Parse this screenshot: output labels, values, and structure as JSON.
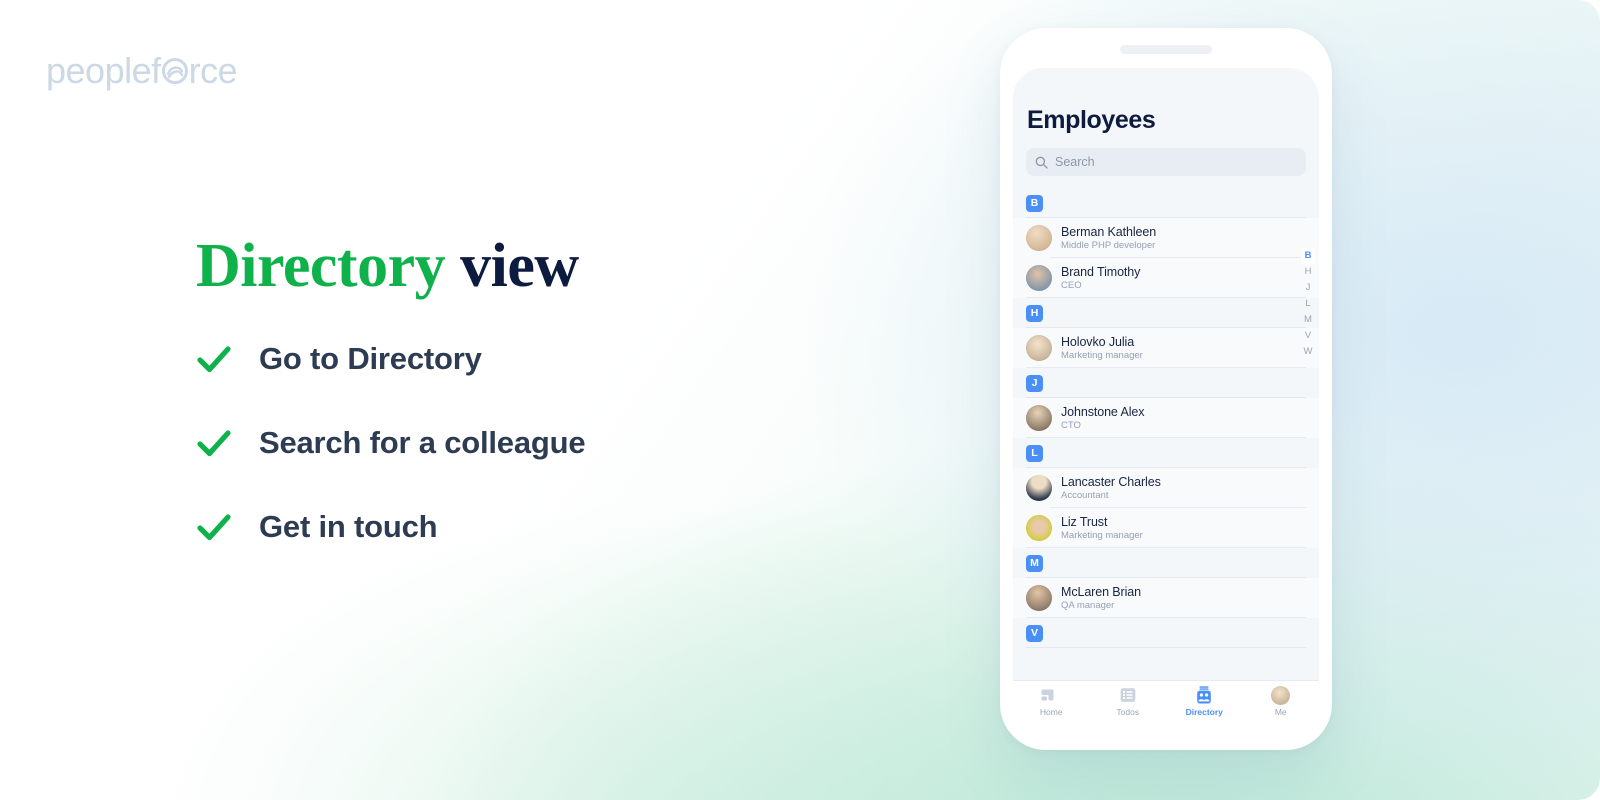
{
  "brand": {
    "logo_text_before": "peoplef",
    "logo_icon": "swirl-o-icon",
    "logo_text_after": "rce",
    "logo_color": "#ccd8e4",
    "green": "#0fb14b",
    "navy": "#0d1b3e",
    "blue": "#4a8ff5"
  },
  "headline": {
    "highlight": "Directory",
    "space": " ",
    "rest": "view"
  },
  "checklist": {
    "items": [
      {
        "icon": "check-icon",
        "label": "Go to Directory"
      },
      {
        "icon": "check-icon",
        "label": "Search for a colleague"
      },
      {
        "icon": "check-icon",
        "label": "Get in touch"
      }
    ]
  },
  "phone": {
    "screen": {
      "title": "Employees",
      "search": {
        "icon": "search-icon",
        "placeholder": "Search",
        "value": ""
      },
      "sections": [
        {
          "letter": "B",
          "employees": [
            {
              "name": "Berman Kathleen",
              "role": "Middle PHP developer",
              "avatar": "#d9c3a8"
            },
            {
              "name": "Brand Timothy",
              "role": "CEO",
              "avatar": "#6f9bc4"
            }
          ]
        },
        {
          "letter": "H",
          "employees": [
            {
              "name": "Holovko Julia",
              "role": "Marketing manager",
              "avatar": "#c9b79c"
            }
          ]
        },
        {
          "letter": "J",
          "employees": [
            {
              "name": "Johnstone Alex",
              "role": "CTO",
              "avatar": "#9a8b78"
            }
          ]
        },
        {
          "letter": "L",
          "employees": [
            {
              "name": "Lancaster Charles",
              "role": "Accountant",
              "avatar": "#445066"
            },
            {
              "name": "Liz Trust",
              "role": "Marketing manager",
              "avatar": "#d8cf3d"
            }
          ]
        },
        {
          "letter": "M",
          "employees": [
            {
              "name": "McLaren Brian",
              "role": "QA manager",
              "avatar": "#8d7f72"
            }
          ]
        },
        {
          "letter": "V",
          "employees": []
        }
      ],
      "alpha_index": {
        "letters": [
          "B",
          "H",
          "J",
          "L",
          "M",
          "V",
          "W"
        ],
        "active": "B"
      },
      "tabbar": {
        "tabs": [
          {
            "icon": "home-icon",
            "label": "Home",
            "active": false
          },
          {
            "icon": "todos-list-icon",
            "label": "Todos",
            "active": false
          },
          {
            "icon": "directory-icon",
            "label": "Directory",
            "active": true
          },
          {
            "icon": "avatar-icon",
            "label": "Me",
            "active": false
          }
        ]
      }
    }
  }
}
